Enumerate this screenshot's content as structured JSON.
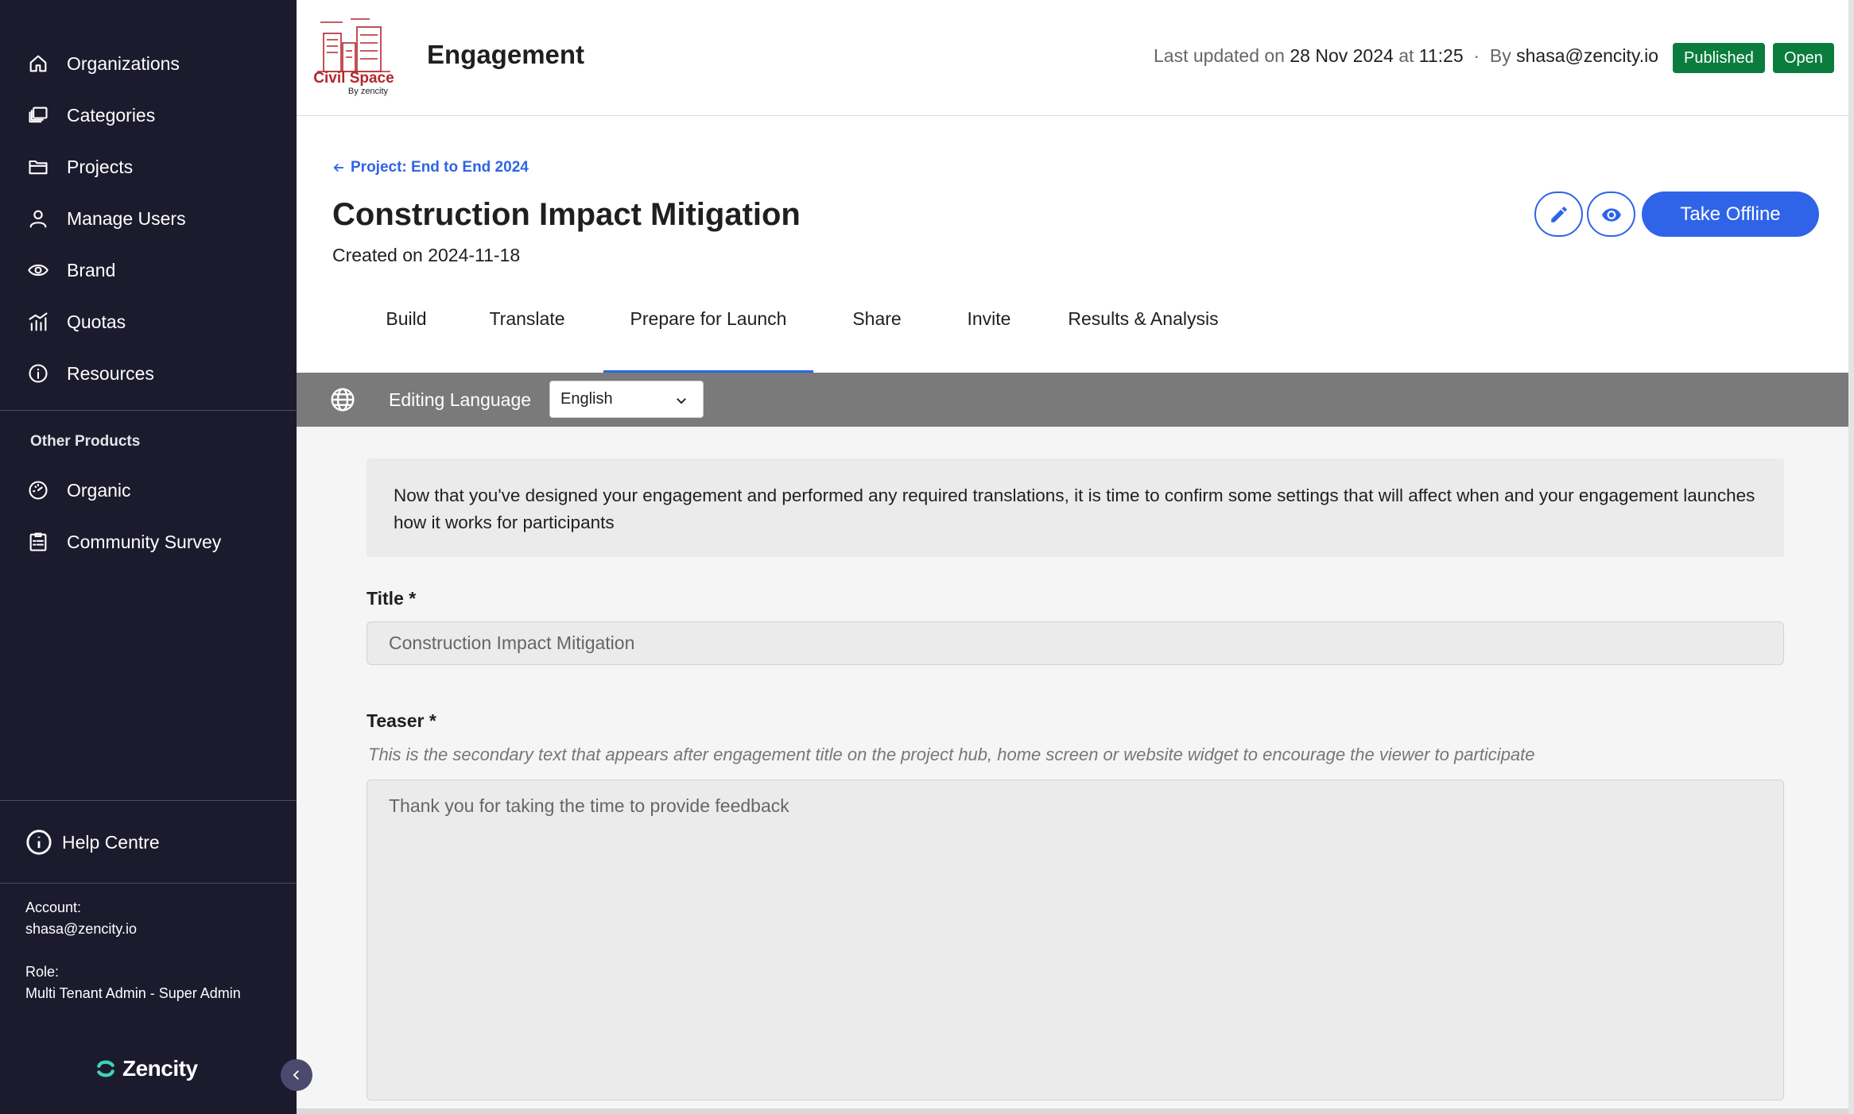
{
  "sidebar": {
    "items": [
      {
        "label": "Organizations",
        "icon": "home-icon"
      },
      {
        "label": "Categories",
        "icon": "stack-icon"
      },
      {
        "label": "Projects",
        "icon": "folder-icon"
      },
      {
        "label": "Manage Users",
        "icon": "user-icon"
      },
      {
        "label": "Brand",
        "icon": "eye-icon"
      },
      {
        "label": "Quotas",
        "icon": "bar-chart-icon"
      },
      {
        "label": "Resources",
        "icon": "info-icon"
      }
    ],
    "other_products_heading": "Other Products",
    "other_products": [
      {
        "label": "Organic",
        "icon": "gauge-icon"
      },
      {
        "label": "Community Survey",
        "icon": "clipboard-icon"
      }
    ],
    "help_label": "Help Centre",
    "account_label": "Account:",
    "account_value": "shasa@zencity.io",
    "role_label": "Role:",
    "role_value": "Multi Tenant Admin - Super Admin",
    "logo_text": "Zencity"
  },
  "header": {
    "logo_text": "Civil Space",
    "logo_subtext": "By zencity",
    "title": "Engagement",
    "meta_prefix": "Last updated on",
    "meta_date": "28 Nov 2024",
    "meta_at": "at",
    "meta_time": "11:25",
    "meta_sep": "·",
    "meta_by": "By",
    "meta_user": "shasa@zencity.io",
    "badge_published": "Published",
    "badge_open": "Open"
  },
  "page": {
    "back_link": "Project: End to End 2024",
    "title": "Construction Impact Mitigation",
    "created": "Created on 2024-11-18",
    "primary_button": "Take Offline",
    "tabs": [
      "Build",
      "Translate",
      "Prepare for Launch",
      "Share",
      "Invite",
      "Results & Analysis"
    ],
    "active_tab": "Prepare for Launch"
  },
  "language_bar": {
    "label": "Editing Language",
    "selected": "English"
  },
  "content": {
    "info_text": "Now that you've designed your engagement and performed any required translations, it is time to confirm some settings that will affect when and your engagement launches how it works for participants",
    "title_label": "Title *",
    "title_value": "Construction Impact Mitigation",
    "teaser_label": "Teaser *",
    "teaser_hint": "This is the secondary text that appears after engagement title on the project hub, home screen or website widget to encourage the viewer to participate",
    "teaser_value": "Thank you for taking the time to provide feedback"
  },
  "colors": {
    "sidebar_bg": "#1c1b2e",
    "accent": "#2f64e8",
    "badge_green": "#0a7d3e",
    "language_bar": "#7a7a7a"
  }
}
